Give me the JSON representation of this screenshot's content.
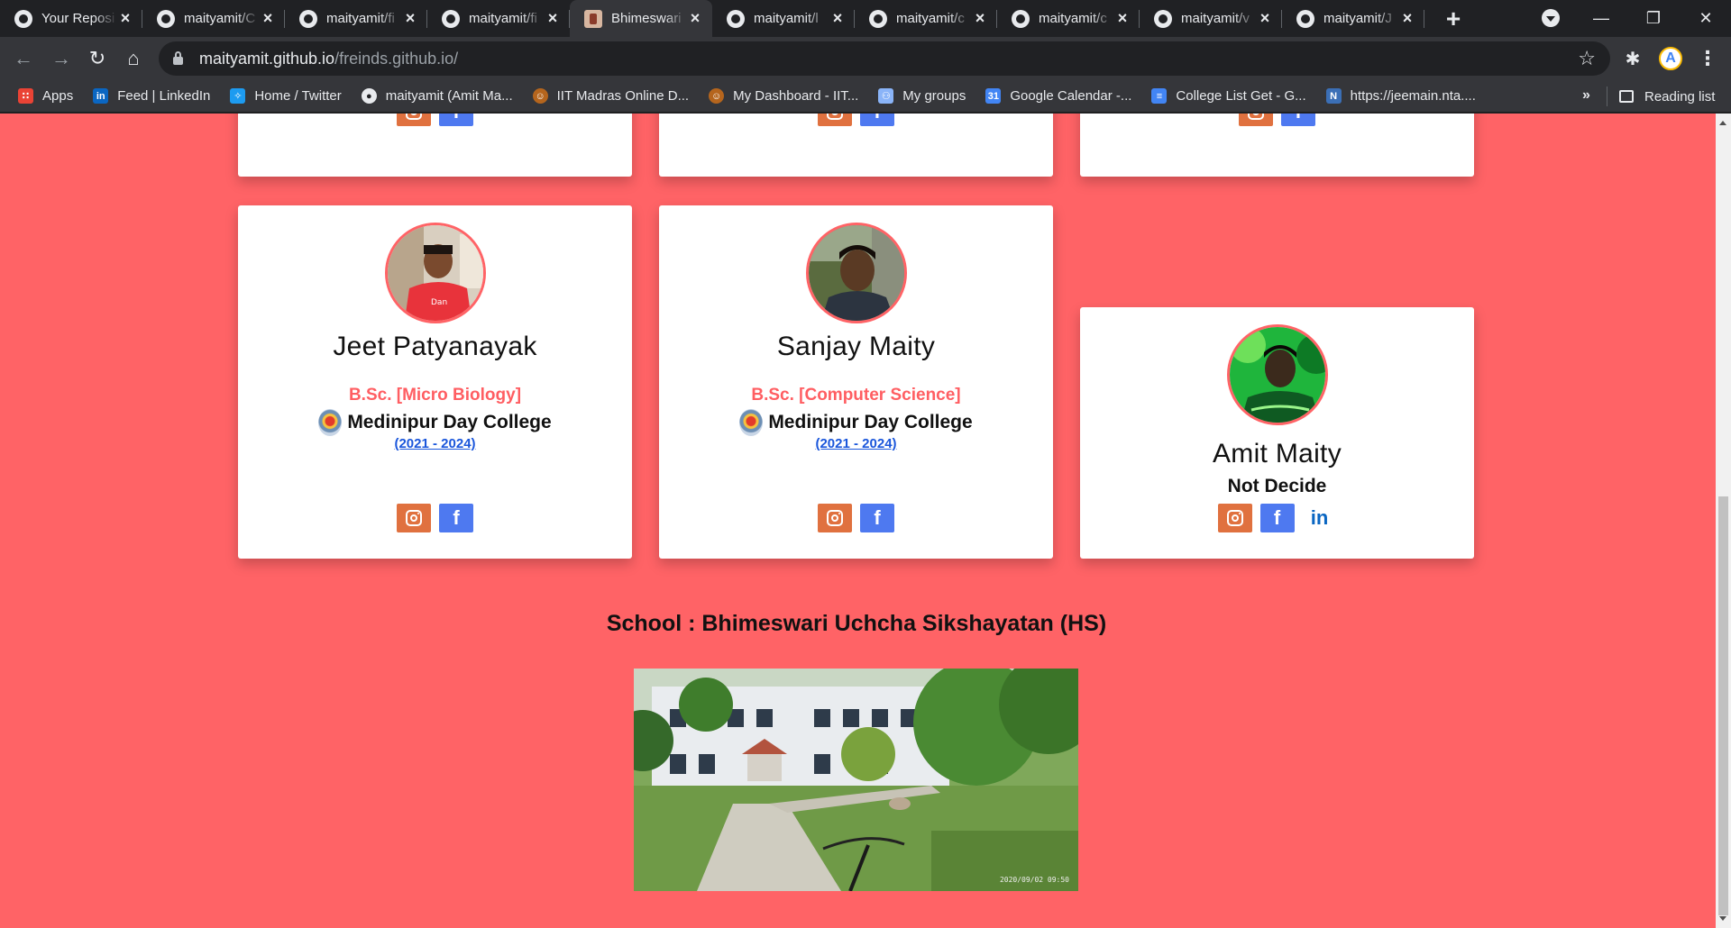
{
  "browser": {
    "tabs": [
      {
        "label": "Your Reposi",
        "active": false,
        "favicon": "github-icon"
      },
      {
        "label": "maityamit/C",
        "active": false,
        "favicon": "github-icon"
      },
      {
        "label": "maityamit/fi",
        "active": false,
        "favicon": "github-icon"
      },
      {
        "label": "maityamit/fi",
        "active": false,
        "favicon": "github-icon"
      },
      {
        "label": "Bhimeswari",
        "active": true,
        "favicon": "school-logo-icon"
      },
      {
        "label": "maityamit/l",
        "active": false,
        "favicon": "github-icon"
      },
      {
        "label": "maityamit/c",
        "active": false,
        "favicon": "github-icon"
      },
      {
        "label": "maityamit/c",
        "active": false,
        "favicon": "github-icon"
      },
      {
        "label": "maityamit/v",
        "active": false,
        "favicon": "github-icon"
      },
      {
        "label": "maityamit/J",
        "active": false,
        "favicon": "github-icon"
      }
    ],
    "url_host": "maityamit.github.io",
    "url_path": "/freinds.github.io/",
    "profile_initial": "A",
    "bookmarks": [
      {
        "label": "Apps",
        "icon": "apps-grid-icon",
        "color": "#ea4335"
      },
      {
        "label": "Feed | LinkedIn",
        "icon": "linkedin-icon",
        "color": "#0a66c2"
      },
      {
        "label": "Home / Twitter",
        "icon": "twitter-icon",
        "color": "#1d9bf0"
      },
      {
        "label": "maityamit (Amit Ma...",
        "icon": "github-icon",
        "color": "#e8eaed"
      },
      {
        "label": "IIT Madras Online D...",
        "icon": "iitm-logo-icon",
        "color": "#b5651d"
      },
      {
        "label": "My Dashboard - IIT...",
        "icon": "iitm-logo-icon",
        "color": "#b5651d"
      },
      {
        "label": "My groups",
        "icon": "groups-icon",
        "color": "#8ab4f8"
      },
      {
        "label": "Google Calendar -...",
        "icon": "calendar-icon",
        "color": "#4285f4"
      },
      {
        "label": "College List Get - G...",
        "icon": "docs-icon",
        "color": "#4285f4"
      },
      {
        "label": "https://jeemain.nta....",
        "icon": "nic-icon",
        "color": "#3b6fb6"
      }
    ],
    "more_bookmarks": "»",
    "reading_list": "Reading list"
  },
  "page": {
    "accent": "#ff6366",
    "top_cards": [
      {
        "position": "left"
      },
      {
        "position": "center"
      },
      {
        "position": "right"
      }
    ],
    "friends": [
      {
        "name": "Jeet Patyanayak",
        "degree": "B.Sc. [Micro Biology]",
        "college": "Medinipur Day College",
        "session": "(2021 - 2024)",
        "socials": [
          "instagram",
          "facebook"
        ]
      },
      {
        "name": "Sanjay Maity",
        "degree": "B.Sc. [Computer Science]",
        "college": "Medinipur Day College",
        "session": "(2021 - 2024)",
        "socials": [
          "instagram",
          "facebook"
        ]
      },
      {
        "name": "Amit Maity",
        "status": "Not Decide",
        "socials": [
          "instagram",
          "facebook",
          "linkedin"
        ]
      }
    ],
    "school_title": "School : Bhimeswari Uchcha Sikshayatan (HS)",
    "school_photo_stamp": "2020/09/02 09:50"
  }
}
